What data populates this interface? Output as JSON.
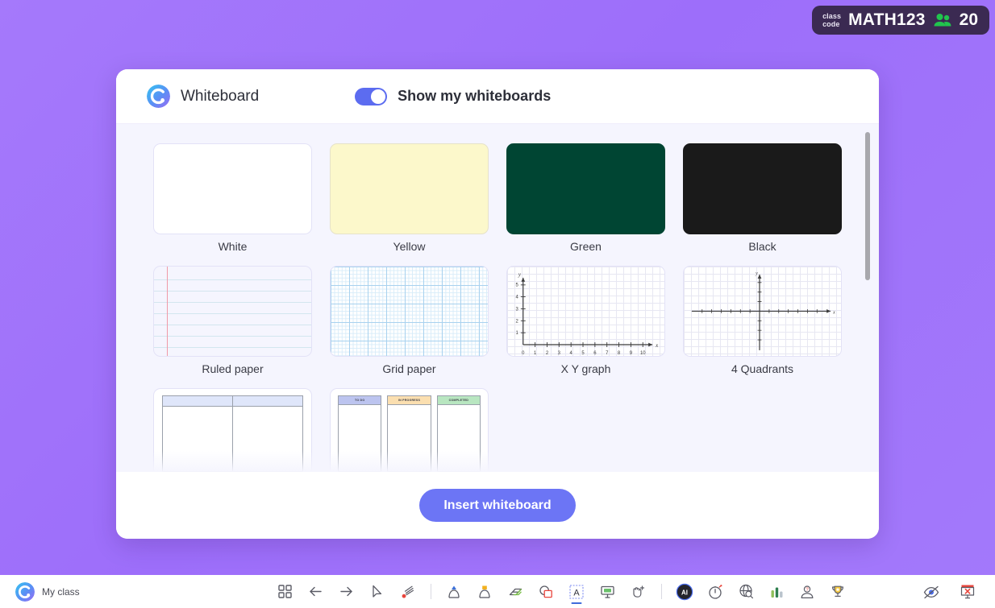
{
  "class_badge": {
    "label_line1": "class",
    "label_line2": "code",
    "code": "MATH123",
    "participants": "20",
    "icon": "people-icon",
    "bg_color": "#3b2a52",
    "icon_color": "#21c44d"
  },
  "modal": {
    "logo_icon": "classpoint-c-logo-icon",
    "title": "Whiteboard",
    "toggle": {
      "label": "Show my whiteboards",
      "state": "on",
      "accent_color": "#5c6cf0"
    },
    "templates": [
      {
        "name": "White",
        "label": "White",
        "kind": "plain",
        "color": "#ffffff"
      },
      {
        "name": "Yellow",
        "label": "Yellow",
        "kind": "plain",
        "color": "#fcf8cb"
      },
      {
        "name": "Green",
        "label": "Green",
        "kind": "plain",
        "color": "#004533"
      },
      {
        "name": "Black",
        "label": "Black",
        "kind": "plain",
        "color": "#1a1a1a"
      },
      {
        "name": "Ruled paper",
        "label": "Ruled paper",
        "kind": "ruled",
        "color": "#ffffff"
      },
      {
        "name": "Grid paper",
        "label": "Grid paper",
        "kind": "grid",
        "color": "#ffffff"
      },
      {
        "name": "X Y graph",
        "label": "X Y graph",
        "kind": "xy",
        "color": "#ffffff"
      },
      {
        "name": "4 Quadrants",
        "label": "4 Quadrants",
        "kind": "quad",
        "color": "#ffffff"
      },
      {
        "name": "Table",
        "label": "",
        "kind": "table",
        "color": "#ffffff"
      },
      {
        "name": "Kanban",
        "label": "",
        "kind": "kanban",
        "color": "#ffffff"
      }
    ],
    "xy_graph": {
      "x_ticks": [
        "0",
        "1",
        "2",
        "3",
        "4",
        "5",
        "6",
        "7",
        "8",
        "9",
        "10"
      ],
      "y_ticks": [
        "1",
        "2",
        "3",
        "4",
        "5"
      ],
      "x_axis_label": "x",
      "y_axis_label": "y"
    },
    "quadrants": {
      "x_axis_label": "x",
      "y_axis_label": "y"
    },
    "kanban_columns": [
      "TO DO",
      "IN PROGRESS",
      "COMPLETED"
    ],
    "insert_button": "Insert whiteboard",
    "insert_button_color": "#6c75f5"
  },
  "toolbar": {
    "my_class_label": "My class",
    "my_class_icon": "classpoint-c-logo-icon",
    "tools": [
      {
        "name": "slide-grid-icon",
        "tooltip": "Slides"
      },
      {
        "name": "arrow-left-icon",
        "tooltip": "Previous"
      },
      {
        "name": "arrow-right-icon",
        "tooltip": "Next"
      },
      {
        "name": "cursor-icon",
        "tooltip": "Select"
      },
      {
        "name": "laser-pointer-icon",
        "tooltip": "Laser pointer"
      },
      {
        "name": "divider",
        "tooltip": ""
      },
      {
        "name": "pen-icon",
        "tooltip": "Pen"
      },
      {
        "name": "highlighter-icon",
        "tooltip": "Highlighter"
      },
      {
        "name": "eraser-icon",
        "tooltip": "Eraser"
      },
      {
        "name": "shapes-icon",
        "tooltip": "Shapes"
      },
      {
        "name": "text-box-icon",
        "tooltip": "Text box"
      },
      {
        "name": "whiteboard-icon",
        "tooltip": "Whiteboard"
      },
      {
        "name": "drag-hand-icon",
        "tooltip": "Drag"
      },
      {
        "name": "divider",
        "tooltip": ""
      },
      {
        "name": "ai-icon",
        "tooltip": "AI"
      },
      {
        "name": "timer-icon",
        "tooltip": "Timer"
      },
      {
        "name": "browser-icon",
        "tooltip": "Embedded browser"
      },
      {
        "name": "bar-chart-icon",
        "tooltip": "Polls"
      },
      {
        "name": "quiz-icon",
        "tooltip": "Quiz"
      },
      {
        "name": "trophy-icon",
        "tooltip": "Leaderboard"
      }
    ],
    "ai_label": "AI",
    "right_tools": [
      {
        "name": "hide-eye-icon",
        "tooltip": "Hide"
      },
      {
        "name": "exit-presentation-icon",
        "tooltip": "Exit"
      }
    ]
  }
}
